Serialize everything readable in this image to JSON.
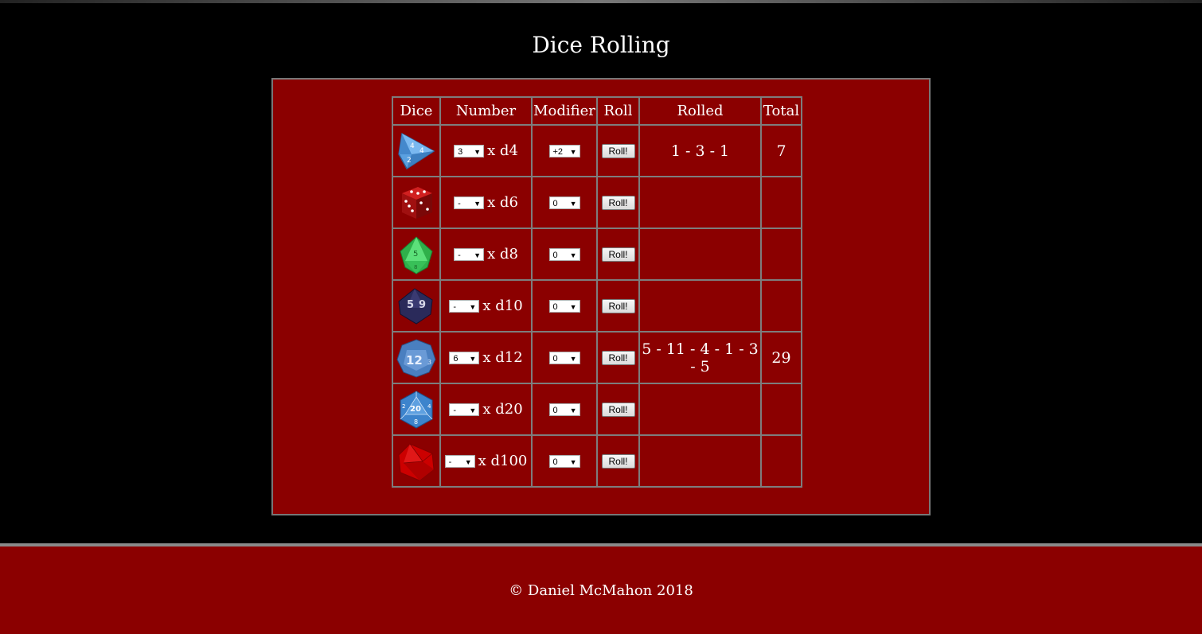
{
  "page": {
    "title": "Dice Rolling"
  },
  "table": {
    "headers": [
      "Dice",
      "Number",
      "Modifier",
      "Roll",
      "Rolled",
      "Total"
    ],
    "rows": [
      {
        "die": "d4",
        "icon": "d4-die-icon",
        "color": "#5aa0e0",
        "number": "3",
        "label": "x d4",
        "modifier": "+2",
        "button": "Roll!",
        "rolled": "1 - 3 - 1",
        "total": "7"
      },
      {
        "die": "d6",
        "icon": "d6-die-icon",
        "color": "#b01010",
        "number": "-",
        "label": "x d6",
        "modifier": "0",
        "button": "Roll!",
        "rolled": "",
        "total": ""
      },
      {
        "die": "d8",
        "icon": "d8-die-icon",
        "color": "#3fd060",
        "number": "-",
        "label": "x d8",
        "modifier": "0",
        "button": "Roll!",
        "rolled": "",
        "total": ""
      },
      {
        "die": "d10",
        "icon": "d10-die-icon",
        "color": "#2a2a5a",
        "number": "-",
        "label": "x d10",
        "modifier": "0",
        "button": "Roll!",
        "rolled": "",
        "total": ""
      },
      {
        "die": "d12",
        "icon": "d12-die-icon",
        "color": "#4a7fc0",
        "number": "6",
        "label": "x d12",
        "modifier": "0",
        "button": "Roll!",
        "rolled": "5 - 11 - 4 - 1 - 3 - 5",
        "total": "29"
      },
      {
        "die": "d20",
        "icon": "d20-die-icon",
        "color": "#3d84cc",
        "number": "-",
        "label": "x d20",
        "modifier": "0",
        "button": "Roll!",
        "rolled": "",
        "total": ""
      },
      {
        "die": "d100",
        "icon": "d100-die-icon",
        "color": "#cc0000",
        "number": "-",
        "label": "x d100",
        "modifier": "0",
        "button": "Roll!",
        "rolled": "",
        "total": ""
      }
    ]
  },
  "footer": {
    "copyright": "© Daniel McMahon 2018"
  },
  "colors": {
    "panel": "#8b0000",
    "background": "#000000",
    "border": "#7d7d7d"
  }
}
